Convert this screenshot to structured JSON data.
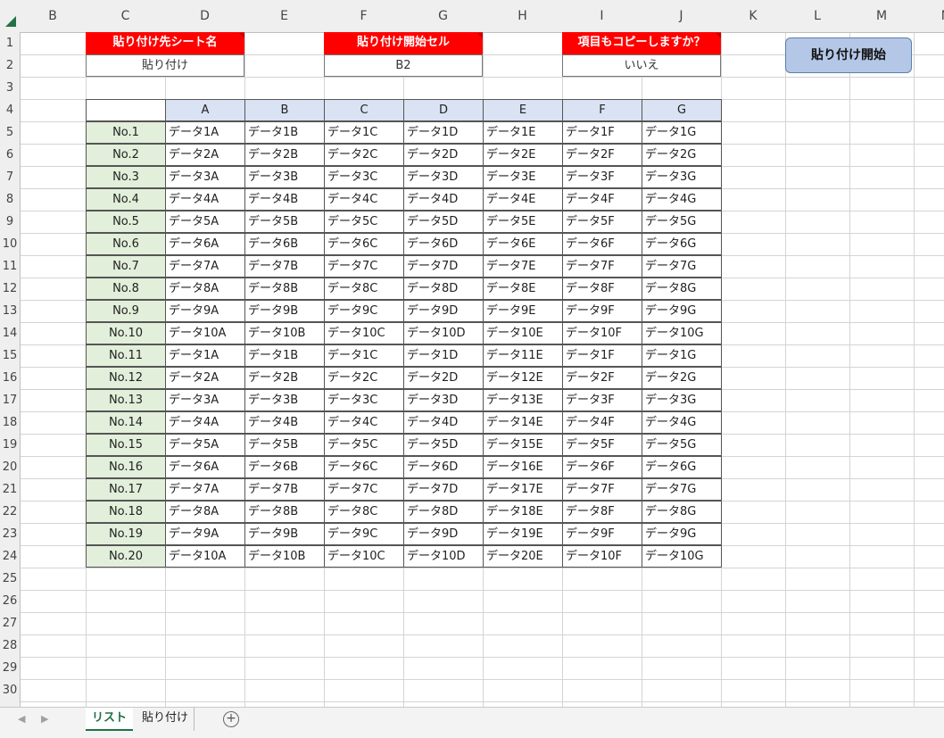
{
  "columns": [
    "B",
    "C",
    "D",
    "E",
    "F",
    "G",
    "H",
    "I",
    "J",
    "K",
    "L",
    "M",
    "N"
  ],
  "rows": [
    "1",
    "2",
    "3",
    "4",
    "5",
    "6",
    "7",
    "8",
    "9",
    "10",
    "11",
    "12",
    "13",
    "14",
    "15",
    "16",
    "17",
    "18",
    "19",
    "20",
    "21",
    "22",
    "23",
    "24",
    "25",
    "26",
    "27",
    "28",
    "29",
    "30"
  ],
  "settings": {
    "paste_sheet_label": "貼り付け先シート名",
    "paste_sheet_value": "貼り付け",
    "paste_cell_label": "貼り付け開始セル",
    "paste_cell_value": "B2",
    "copy_header_label": "項目もコピーしますか？",
    "copy_header_value": "いいえ"
  },
  "start_button_label": "貼り付け開始",
  "table": {
    "headers": [
      "A",
      "B",
      "C",
      "D",
      "E",
      "F",
      "G"
    ],
    "rows": [
      {
        "no": "No.1",
        "cells": [
          "データ1A",
          "データ1B",
          "データ1C",
          "データ1D",
          "データ1E",
          "データ1F",
          "データ1G"
        ]
      },
      {
        "no": "No.2",
        "cells": [
          "データ2A",
          "データ2B",
          "データ2C",
          "データ2D",
          "データ2E",
          "データ2F",
          "データ2G"
        ]
      },
      {
        "no": "No.3",
        "cells": [
          "データ3A",
          "データ3B",
          "データ3C",
          "データ3D",
          "データ3E",
          "データ3F",
          "データ3G"
        ]
      },
      {
        "no": "No.4",
        "cells": [
          "データ4A",
          "データ4B",
          "データ4C",
          "データ4D",
          "データ4E",
          "データ4F",
          "データ4G"
        ]
      },
      {
        "no": "No.5",
        "cells": [
          "データ5A",
          "データ5B",
          "データ5C",
          "データ5D",
          "データ5E",
          "データ5F",
          "データ5G"
        ]
      },
      {
        "no": "No.6",
        "cells": [
          "データ6A",
          "データ6B",
          "データ6C",
          "データ6D",
          "データ6E",
          "データ6F",
          "データ6G"
        ]
      },
      {
        "no": "No.7",
        "cells": [
          "データ7A",
          "データ7B",
          "データ7C",
          "データ7D",
          "データ7E",
          "データ7F",
          "データ7G"
        ]
      },
      {
        "no": "No.8",
        "cells": [
          "データ8A",
          "データ8B",
          "データ8C",
          "データ8D",
          "データ8E",
          "データ8F",
          "データ8G"
        ]
      },
      {
        "no": "No.9",
        "cells": [
          "データ9A",
          "データ9B",
          "データ9C",
          "データ9D",
          "データ9E",
          "データ9F",
          "データ9G"
        ]
      },
      {
        "no": "No.10",
        "cells": [
          "データ10A",
          "データ10B",
          "データ10C",
          "データ10D",
          "データ10E",
          "データ10F",
          "データ10G"
        ]
      },
      {
        "no": "No.11",
        "cells": [
          "データ1A",
          "データ1B",
          "データ1C",
          "データ1D",
          "データ11E",
          "データ1F",
          "データ1G"
        ]
      },
      {
        "no": "No.12",
        "cells": [
          "データ2A",
          "データ2B",
          "データ2C",
          "データ2D",
          "データ12E",
          "データ2F",
          "データ2G"
        ]
      },
      {
        "no": "No.13",
        "cells": [
          "データ3A",
          "データ3B",
          "データ3C",
          "データ3D",
          "データ13E",
          "データ3F",
          "データ3G"
        ]
      },
      {
        "no": "No.14",
        "cells": [
          "データ4A",
          "データ4B",
          "データ4C",
          "データ4D",
          "データ14E",
          "データ4F",
          "データ4G"
        ]
      },
      {
        "no": "No.15",
        "cells": [
          "データ5A",
          "データ5B",
          "データ5C",
          "データ5D",
          "データ15E",
          "データ5F",
          "データ5G"
        ]
      },
      {
        "no": "No.16",
        "cells": [
          "データ6A",
          "データ6B",
          "データ6C",
          "データ6D",
          "データ16E",
          "データ6F",
          "データ6G"
        ]
      },
      {
        "no": "No.17",
        "cells": [
          "データ7A",
          "データ7B",
          "データ7C",
          "データ7D",
          "データ17E",
          "データ7F",
          "データ7G"
        ]
      },
      {
        "no": "No.18",
        "cells": [
          "データ8A",
          "データ8B",
          "データ8C",
          "データ8D",
          "データ18E",
          "データ8F",
          "データ8G"
        ]
      },
      {
        "no": "No.19",
        "cells": [
          "データ9A",
          "データ9B",
          "データ9C",
          "データ9D",
          "データ19E",
          "データ9F",
          "データ9G"
        ]
      },
      {
        "no": "No.20",
        "cells": [
          "データ10A",
          "データ10B",
          "データ10C",
          "データ10D",
          "データ20E",
          "データ10F",
          "データ10G"
        ]
      }
    ]
  },
  "sheet_tabs": [
    "リスト",
    "貼り付け"
  ],
  "add_sheet_icon": "+"
}
